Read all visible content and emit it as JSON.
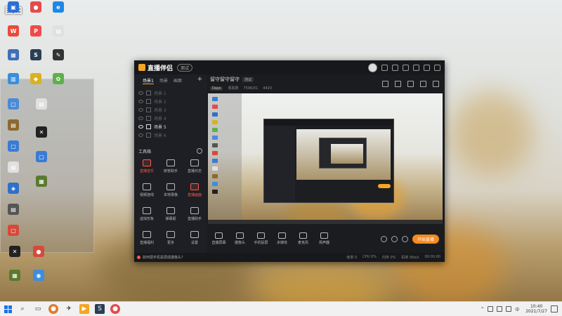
{
  "desktop": {
    "watermark": "自由",
    "icons_row1": [
      {
        "label": "",
        "color": "#2a6fd6",
        "glyph": "▣"
      },
      {
        "label": "",
        "color": "#e34b4b",
        "glyph": "●"
      },
      {
        "label": "",
        "color": "#1e88e5",
        "glyph": "e"
      }
    ],
    "icons_row2": [
      {
        "label": "",
        "color": "#e84b3c",
        "glyph": "W"
      },
      {
        "label": "",
        "color": "#f04b4b",
        "glyph": "P"
      },
      {
        "label": "",
        "color": "#e0e0e0",
        "glyph": "▤"
      }
    ],
    "icons_row3": [
      {
        "label": "",
        "color": "#3f6fb5",
        "glyph": "▦"
      },
      {
        "label": "",
        "color": "#2a3e55",
        "glyph": "S"
      },
      {
        "label": "",
        "color": "#333333",
        "glyph": "✎"
      }
    ],
    "icons_row4": [
      {
        "label": "",
        "color": "#3b8fd8",
        "glyph": "▥"
      },
      {
        "label": "",
        "color": "#d9b21f",
        "glyph": "◆"
      },
      {
        "label": "",
        "color": "#5fb04d",
        "glyph": "✿"
      }
    ],
    "left_col_icons": [
      {
        "label": "",
        "color": "#4d8ad8",
        "glyph": "▢"
      },
      {
        "label": "",
        "color": "#8c6a2e",
        "glyph": "▤"
      },
      {
        "label": "",
        "color": "#3a7bd5",
        "glyph": "▢"
      },
      {
        "label": "",
        "color": "#e0e0e0",
        "glyph": "▤"
      },
      {
        "label": "",
        "color": "#2e71c9",
        "glyph": "◈"
      },
      {
        "label": "",
        "color": "#555555",
        "glyph": "▤"
      },
      {
        "label": "",
        "color": "#d64a3b",
        "glyph": "▢"
      }
    ],
    "bottom_icons": [
      {
        "label": "",
        "color": "#222222",
        "glyph": "✕"
      },
      {
        "label": "",
        "color": "#d64a3b",
        "glyph": "●"
      },
      {
        "label": "",
        "color": "#5a7a2e",
        "glyph": "▦"
      },
      {
        "label": "",
        "color": "#3c8ee0",
        "glyph": "◉"
      }
    ]
  },
  "app": {
    "title": "直播伴侣",
    "beta": "测试",
    "tabs": [
      "场景1",
      "场景",
      "画面"
    ],
    "scenes": [
      {
        "label": "场景 1",
        "on": false
      },
      {
        "label": "场景 2",
        "on": false
      },
      {
        "label": "场景 3",
        "on": false
      },
      {
        "label": "场景 4",
        "on": false
      },
      {
        "label": "场景 5",
        "on": true
      },
      {
        "label": "场景 6",
        "on": false
      }
    ],
    "toolbox_title": "工具箱",
    "tools": [
      {
        "label": "直播音乐",
        "red": true
      },
      {
        "label": "房管助手",
        "red": false
      },
      {
        "label": "直播日志",
        "red": false
      },
      {
        "label": "视频连线",
        "red": false
      },
      {
        "label": "本地录像",
        "red": false
      },
      {
        "label": "直播画面",
        "red": true
      },
      {
        "label": "虚拟形象",
        "red": false
      },
      {
        "label": "弹幕姬",
        "red": false
      },
      {
        "label": "直播助手",
        "red": false
      },
      {
        "label": "直播福利",
        "red": false
      },
      {
        "label": "更多",
        "red": false
      },
      {
        "label": "设置",
        "red": false
      }
    ],
    "stream_title": "留守留守留守",
    "stream_tag": "测试",
    "stream_game": "Days",
    "stream_meta1": "观看数",
    "stream_meta2": "7596/01",
    "stream_meta3": "4420",
    "controls": [
      "直播屏幕",
      "摄像头",
      "手机投屏",
      "多媒体",
      "麦克风",
      "扬声器"
    ],
    "start_live": "开始直播",
    "status_hint": "如何把手机投屏成摄像头？",
    "status_stats": [
      "帧率 0",
      "CPU 0%",
      "内存 0%",
      "码率 0kb/s",
      "00:00:00"
    ]
  },
  "taskbar": {
    "time": "10:40",
    "date": "2021/7/27",
    "ime": "中"
  }
}
